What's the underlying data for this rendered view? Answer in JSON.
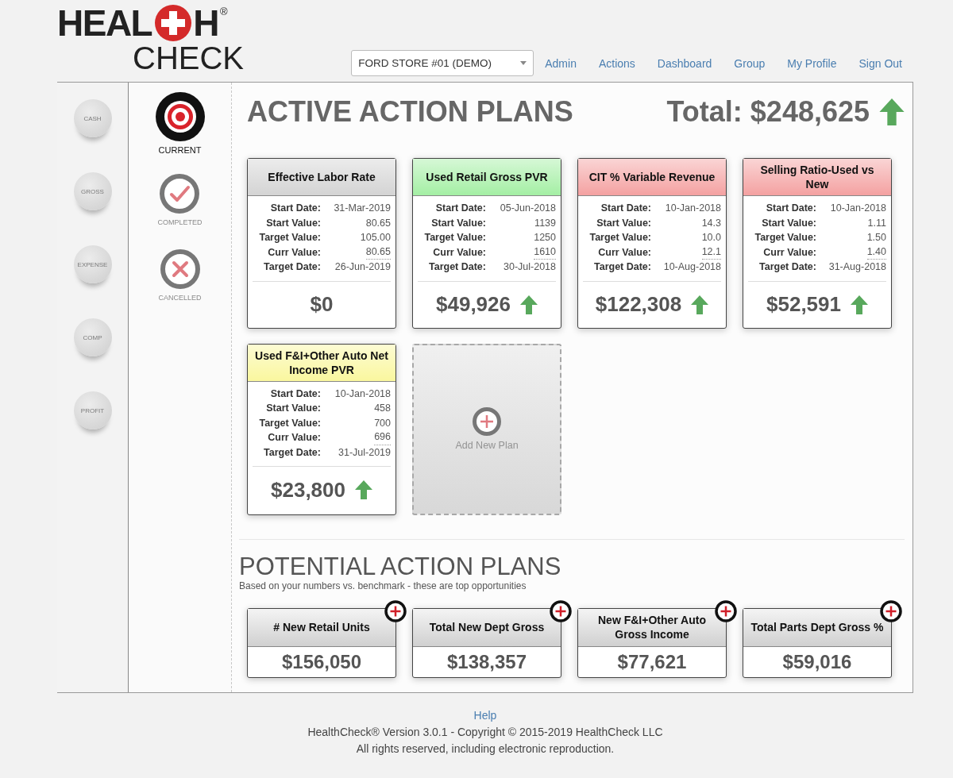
{
  "logo": {
    "word_start": "HEAL",
    "word_end": "H",
    "registered": "®",
    "subtitle": "CHECK"
  },
  "store_select": {
    "value": "FORD STORE #01 (DEMO)"
  },
  "nav_links": [
    "Admin",
    "Actions",
    "Dashboard",
    "Group",
    "My Profile",
    "Sign Out"
  ],
  "categories": [
    {
      "label": "CASH",
      "selected": false
    },
    {
      "label": "GROSS",
      "selected": false
    },
    {
      "label": "EXPENSE",
      "selected": false
    },
    {
      "label": "COMP",
      "selected": false
    },
    {
      "label": "PROFIT",
      "selected": false
    }
  ],
  "status_filters": [
    {
      "kind": "target",
      "label": "CURRENT",
      "selected": true
    },
    {
      "kind": "check",
      "label": "COMPLETED",
      "selected": false
    },
    {
      "kind": "cross",
      "label": "CANCELLED",
      "selected": false
    }
  ],
  "active_plans": {
    "title": "ACTIVE ACTION PLANS",
    "total": "Total: $248,625",
    "total_rising": true,
    "cards": [
      {
        "title": "Effective Labor Rate",
        "color": "#d4d4d4",
        "fields": [
          {
            "label": "Start Date:",
            "value": "31-Mar-2019",
            "editable": false
          },
          {
            "label": "Start Value:",
            "value": "80.65",
            "editable": false
          },
          {
            "label": "Target Value:",
            "value": "105.00",
            "editable": false
          },
          {
            "label": "Curr Value:",
            "value": "80.65",
            "editable": true
          },
          {
            "label": "Target Date:",
            "value": "26-Jun-2019",
            "editable": false
          }
        ],
        "amount": "$0",
        "rising": false
      },
      {
        "title": "Used Retail Gross PVR",
        "color": "#a4efa4",
        "fields": [
          {
            "label": "Start Date:",
            "value": "05-Jun-2018",
            "editable": false
          },
          {
            "label": "Start Value:",
            "value": "1139",
            "editable": false
          },
          {
            "label": "Target Value:",
            "value": "1250",
            "editable": false
          },
          {
            "label": "Curr Value:",
            "value": "1610",
            "editable": true
          },
          {
            "label": "Target Date:",
            "value": "30-Jul-2018",
            "editable": false
          }
        ],
        "amount": "$49,926",
        "rising": true
      },
      {
        "title": "CIT % Variable Revenue",
        "color": "#f4a1a1",
        "fields": [
          {
            "label": "Start Date:",
            "value": "10-Jan-2018",
            "editable": false
          },
          {
            "label": "Start Value:",
            "value": "14.3",
            "editable": false
          },
          {
            "label": "Target Value:",
            "value": "10.0",
            "editable": false
          },
          {
            "label": "Curr Value:",
            "value": "12.1",
            "editable": true
          },
          {
            "label": "Target Date:",
            "value": "10-Aug-2018",
            "editable": false
          }
        ],
        "amount": "$122,308",
        "rising": true
      },
      {
        "title": "Selling Ratio-Used vs New",
        "color": "#f4a1a1",
        "fields": [
          {
            "label": "Start Date:",
            "value": "10-Jan-2018",
            "editable": false
          },
          {
            "label": "Start Value:",
            "value": "1.11",
            "editable": false
          },
          {
            "label": "Target Value:",
            "value": "1.50",
            "editable": false
          },
          {
            "label": "Curr Value:",
            "value": "1.40",
            "editable": true
          },
          {
            "label": "Target Date:",
            "value": "31-Aug-2018",
            "editable": false
          }
        ],
        "amount": "$52,591",
        "rising": true
      },
      {
        "title": "Used F&I+Other Auto Net Income PVR",
        "color": "#faf79e",
        "fields": [
          {
            "label": "Start Date:",
            "value": "10-Jan-2018",
            "editable": false
          },
          {
            "label": "Start Value:",
            "value": "458",
            "editable": false
          },
          {
            "label": "Target Value:",
            "value": "700",
            "editable": false
          },
          {
            "label": "Curr Value:",
            "value": "696",
            "editable": true
          },
          {
            "label": "Target Date:",
            "value": "31-Jul-2019",
            "editable": false
          }
        ],
        "amount": "$23,800",
        "rising": true
      }
    ],
    "add_tile": {
      "label": "Add New Plan"
    }
  },
  "potential_plans": {
    "title": "POTENTIAL ACTION PLANS",
    "subtitle": "Based on your numbers vs. benchmark - these are top opportunities",
    "cards": [
      {
        "title": "# New Retail Units",
        "amount": "$156,050"
      },
      {
        "title": "Total New Dept Gross",
        "amount": "$138,357"
      },
      {
        "title": "New F&I+Other Auto Gross Income",
        "amount": "$77,621"
      },
      {
        "title": "Total Parts Dept Gross %",
        "amount": "$59,016"
      }
    ]
  },
  "footer": {
    "help": "Help",
    "copyright": "HealthCheck® Version 3.0.1 - Copyright © 2015-2019 HealthCheck LLC",
    "rights": "All rights reserved, including electronic reproduction."
  }
}
